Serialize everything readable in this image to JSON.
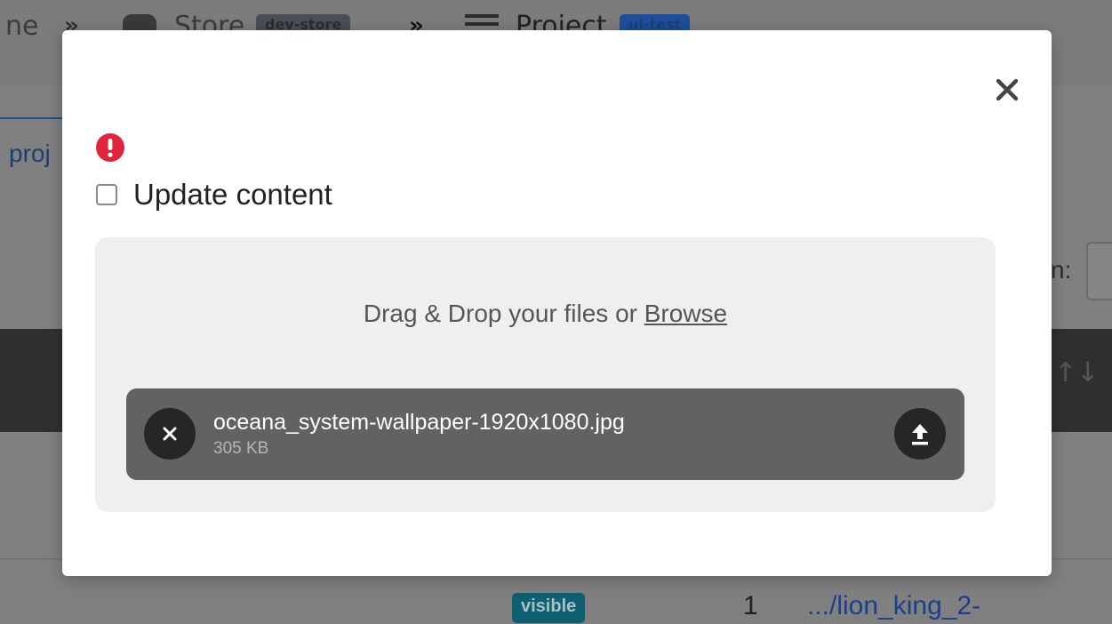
{
  "background": {
    "breadcrumb": {
      "home_partial": "ne",
      "store_label": "Store",
      "store_badge": "dev-store",
      "project_label": "Project",
      "project_badge": "ui-test"
    },
    "tab_partial": "proj",
    "filter_label_partial": "n:",
    "row": {
      "status_badge": "visible",
      "number": "1",
      "link": ".../lion_king_2-"
    }
  },
  "modal": {
    "checkbox_label": "Update content",
    "checkbox_checked": false,
    "alert_icon": "exclamation-circle-icon",
    "close_icon": "close-icon",
    "dropzone": {
      "prompt": "Drag & Drop your files or ",
      "browse_label": "Browse"
    },
    "file": {
      "name": "oceana_system-wallpaper-1920x1080.jpg",
      "size": "305 KB",
      "remove_icon": "close-icon",
      "upload_icon": "upload-icon"
    }
  },
  "colors": {
    "overlay": "#808080",
    "alert_red": "#e0243c",
    "file_item_bg": "#646260",
    "dropzone_bg": "#f0efee",
    "badge_teal": "#0e6070",
    "link_blue": "#1b3f8a"
  }
}
